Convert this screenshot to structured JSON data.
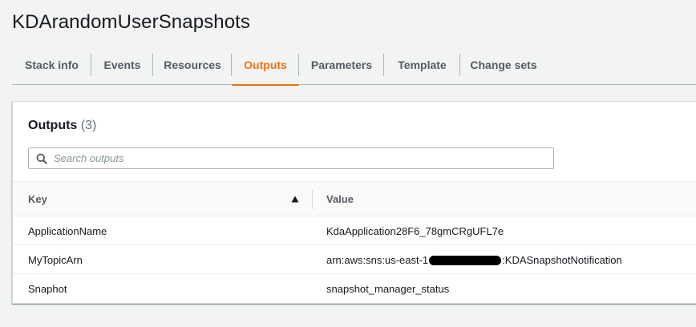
{
  "stack": {
    "title": "KDArandomUserSnapshots"
  },
  "tabs": [
    {
      "label": "Stack info",
      "active": false
    },
    {
      "label": "Events",
      "active": false
    },
    {
      "label": "Resources",
      "active": false
    },
    {
      "label": "Outputs",
      "active": true
    },
    {
      "label": "Parameters",
      "active": false
    },
    {
      "label": "Template",
      "active": false
    },
    {
      "label": "Change sets",
      "active": false
    }
  ],
  "outputs": {
    "heading": "Outputs",
    "count": "(3)",
    "search": {
      "placeholder": "Search outputs",
      "value": ""
    },
    "columns": {
      "key": "Key",
      "value": "Value"
    },
    "sort": {
      "column": "Key",
      "direction": "ascending"
    },
    "rows": [
      {
        "key": "ApplicationName",
        "value": "KdaApplication28F6_78gmCRgUFL7e",
        "value_suffix": "",
        "redacted": false
      },
      {
        "key": "MyTopicArn",
        "value": "arn:aws:sns:us-east-1",
        "value_suffix": ":KDASnapshotNotification",
        "redacted": true
      },
      {
        "key": "Snaphot",
        "value": "snapshot_manager_status",
        "value_suffix": "",
        "redacted": false
      }
    ]
  },
  "colors": {
    "accent_active_tab": "#ec7211",
    "background": "#f2f3f3",
    "panel": "#ffffff"
  },
  "icons": {
    "search": "search-icon",
    "sort": "sort-ascending-icon"
  }
}
